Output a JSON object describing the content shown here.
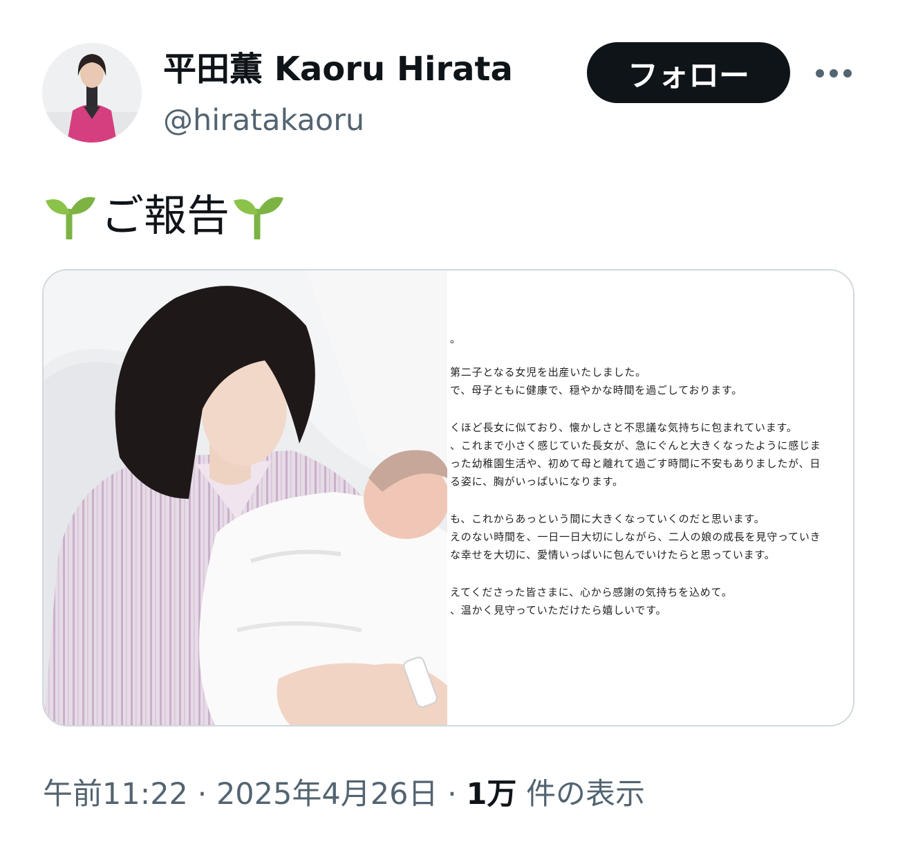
{
  "author": {
    "display_name": "平田薫 Kaoru Hirata",
    "handle": "@hiratakaoru",
    "avatar_icon": "profile-photo"
  },
  "actions": {
    "follow_label": "フォロー",
    "more_icon": "more-horizontal-icon"
  },
  "tweet": {
    "text": "ご報告",
    "emoji": "seedling",
    "media_alt_photo": "mother-holding-newborn-photo",
    "letter_lines": [
      "。",
      "第二子となる女児を出産いたしました。",
      "で、母子ともに健康で、穏やかな時間を過ごしております。",
      "くほど長女に似ており、懐かしさと不思議な気持ちに包まれています。",
      "、これまで小さく感じていた長女が、急にぐんと大きくなったように感じま",
      "った幼稚園生活や、初めて母と離れて過ごす時間に不安もありましたが、日",
      "る姿に、胸がいっぱいになります。",
      "も、これからあっという間に大きくなっていくのだと思います。",
      "えのない時間を、一日一日大切にしながら、二人の娘の成長を見守っていき",
      "な幸せを大切に、愛情いっぱいに包んでいけたらと思っています。",
      "えてくださった皆さまに、心から感謝の気持ちを込めて。",
      "、温かく見守っていただけたら嬉しいです。"
    ]
  },
  "meta": {
    "time": "午前11:22",
    "separator": " · ",
    "date": "2025年4月26日",
    "views_count": "1万",
    "views_label": "件の表示"
  },
  "colors": {
    "primary_text": "#0f1419",
    "secondary_text": "#536471",
    "border": "#cfd9de",
    "follow_bg": "#0f1419",
    "sprout_green": "#7cb342"
  }
}
